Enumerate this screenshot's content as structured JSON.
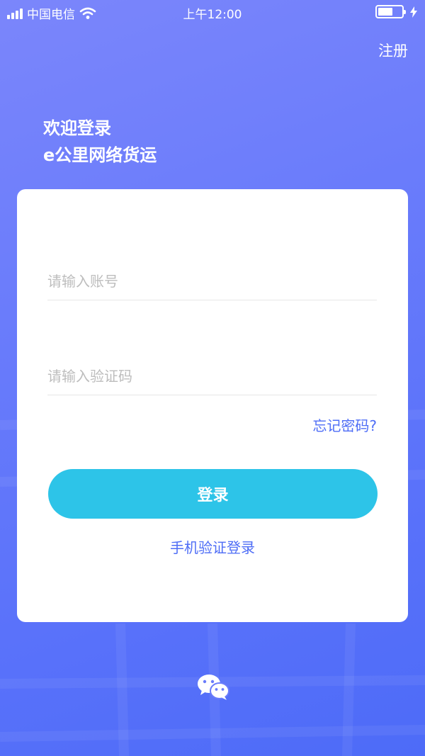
{
  "status_bar": {
    "carrier": "中国电信",
    "time": "上午12:00"
  },
  "header": {
    "register_label": "注册",
    "welcome_line1": "欢迎登录",
    "welcome_line2": "e公里网络货运"
  },
  "form": {
    "account_placeholder": "请输入账号",
    "account_value": "",
    "code_placeholder": "请输入验证码",
    "code_value": "",
    "forgot_label": "忘记密码?",
    "login_label": "登录",
    "phone_login_label": "手机验证登录"
  },
  "icons": {
    "signal": "signal-icon",
    "wifi": "wifi-icon",
    "battery": "battery-icon",
    "charging": "charging-icon",
    "wechat": "wechat-icon"
  },
  "colors": {
    "background_start": "#7b86fb",
    "background_end": "#4d6bf8",
    "button": "#2dc4e8",
    "link": "#4e6df6"
  }
}
